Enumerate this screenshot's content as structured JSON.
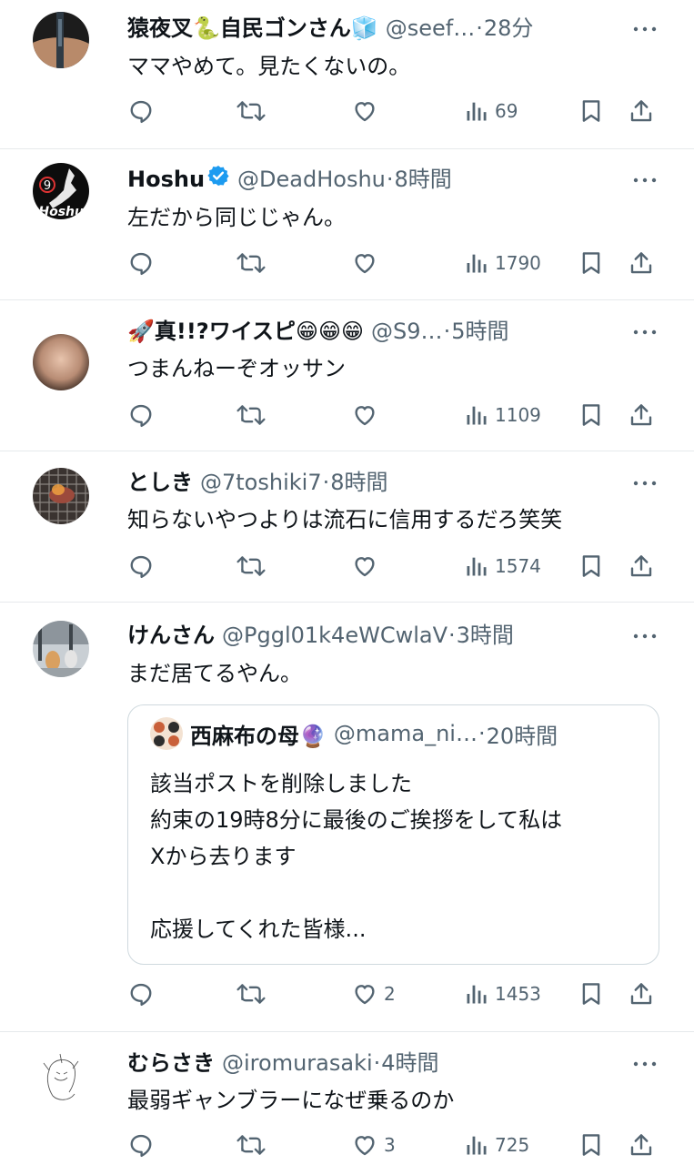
{
  "posts": [
    {
      "name": "猿夜叉🐍自民ゴンさん🧊",
      "handle": "@seef…",
      "time": "28分",
      "text": "ママやめて。見たくないの。",
      "replies": "",
      "retweets": "",
      "likes": "",
      "views": "69"
    },
    {
      "name": "Hoshu",
      "handle": "@DeadHoshu",
      "time": "8時間",
      "text": "左だから同じじゃん。",
      "replies": "",
      "retweets": "",
      "likes": "",
      "views": "1790",
      "avatar_text": "Hoshu",
      "avatar_number": "9"
    },
    {
      "name": "🚀真!!?ワイスピ😁😁😁",
      "handle": "@S9…",
      "time": "5時間",
      "text": "つまんねーぞオッサン",
      "replies": "",
      "retweets": "",
      "likes": "",
      "views": "1109"
    },
    {
      "name": "としき",
      "handle": "@7toshiki7",
      "time": "8時間",
      "text": "知らないやつよりは流石に信用するだろ笑笑",
      "replies": "",
      "retweets": "",
      "likes": "",
      "views": "1574"
    },
    {
      "name": "けんさん",
      "handle": "@Pggl01k4eWCwlaV",
      "time": "3時間",
      "text": "まだ居てるやん。",
      "replies": "",
      "retweets": "",
      "likes": "2",
      "views": "1453",
      "quote": {
        "name": "西麻布の母🔮",
        "handle": "@mama_ni…",
        "time": "20時間",
        "text": "該当ポストを削除しました\n約束の19時8分に最後のご挨拶をして私は\nXから去ります\n\n応援してくれた皆様..."
      }
    },
    {
      "name": "むらさき",
      "handle": "@iromurasaki",
      "time": "4時間",
      "text": "最弱ギャンブラーになぜ乗るのか",
      "replies": "",
      "retweets": "",
      "likes": "3",
      "views": "725"
    }
  ],
  "ui": {
    "dot": "·"
  },
  "icons": [
    "reply-icon",
    "retweet-icon",
    "like-icon",
    "views-icon",
    "bookmark-icon",
    "share-icon",
    "more-icon",
    "verified-badge-icon"
  ],
  "colors": {
    "text": "#0f1419",
    "muted": "#536471",
    "divider": "#e6e9ec",
    "verified": "#1d9bf0"
  }
}
